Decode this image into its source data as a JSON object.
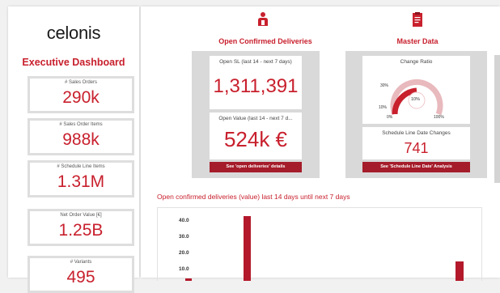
{
  "sidebar": {
    "logo": "celonis",
    "title": "Executive Dashboard",
    "kpis": [
      {
        "label": "# Sales Orders",
        "value": "290k"
      },
      {
        "label": "# Sales Order Items",
        "value": "988k"
      },
      {
        "label": "# Schedule Line Items",
        "value": "1.31M"
      },
      {
        "label": "Net Order Value [€]",
        "value": "1.25B"
      },
      {
        "label": "# Variants",
        "value": "495"
      }
    ]
  },
  "sections": {
    "deliveries": {
      "title": "Open Confirmed Deliveries",
      "icon": "person-presenting-icon",
      "card1_label": "Open SL (last 14 - next 7 days)",
      "card1_value": "1,311,391",
      "card2_label": "Open Value (last 14 - next 7 d...",
      "card2_value": "524k €",
      "button": "See 'open deliveries' details"
    },
    "master_data": {
      "title": "Master Data",
      "icon": "clipboard-icon",
      "gauge_label": "Change Ratio",
      "gauge_center": "10%",
      "gauge_ticks": [
        "30%",
        "10%",
        "0%",
        "100%"
      ],
      "card2_label": "Schedule Line Date Changes",
      "card2_value": "741",
      "button": "See 'Schedule Line Date' Analysis"
    }
  },
  "chart_data": {
    "type": "bar",
    "title": "Open confirmed deliveries (value) last 14 days until next 7 days",
    "yticks": [
      "40.0",
      "30.0",
      "20.0",
      "10.0"
    ],
    "series": [
      {
        "values": [
          1.5,
          47,
          12
        ]
      }
    ],
    "colors": {
      "bar": "#b3192b"
    }
  },
  "colors": {
    "accent": "#c8202d",
    "button": "#a51c2a",
    "panel": "#d9d9d9"
  }
}
